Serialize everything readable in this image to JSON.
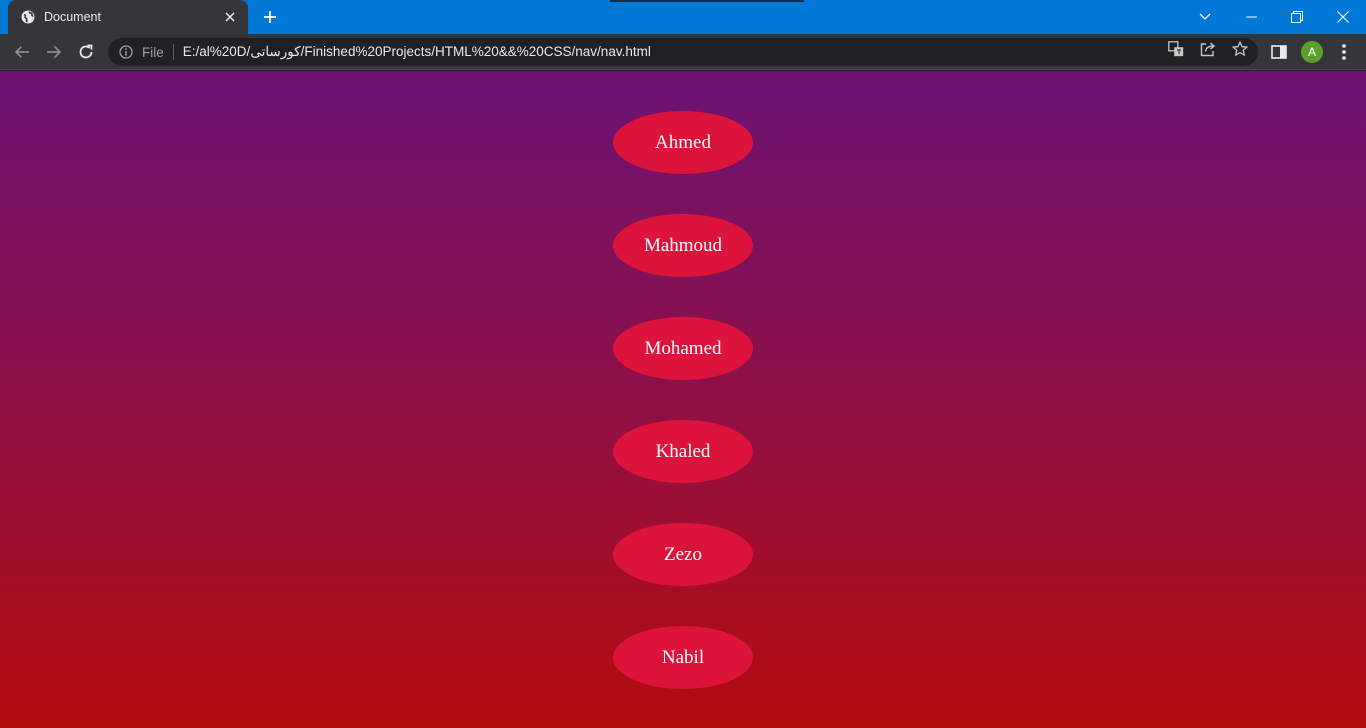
{
  "browser": {
    "tab": {
      "title": "Document"
    },
    "address_bar": {
      "scheme_label": "File",
      "url": "E:/al%20D/كورساتى/Finished%20Projects/HTML%20&&%20CSS/nav/nav.html"
    },
    "profile": {
      "initial": "A"
    }
  },
  "page": {
    "nav_items": [
      {
        "label": "Ahmed"
      },
      {
        "label": "Mahmoud"
      },
      {
        "label": "Mohamed"
      },
      {
        "label": "Khaled"
      },
      {
        "label": "Zezo"
      },
      {
        "label": "Nabil"
      }
    ]
  },
  "colors": {
    "gradient_top": "#6c1374",
    "gradient_bottom": "#b40c0c",
    "item_background": "#dc143c",
    "item_text": "#ffffff",
    "titlebar": "#0078d7"
  }
}
